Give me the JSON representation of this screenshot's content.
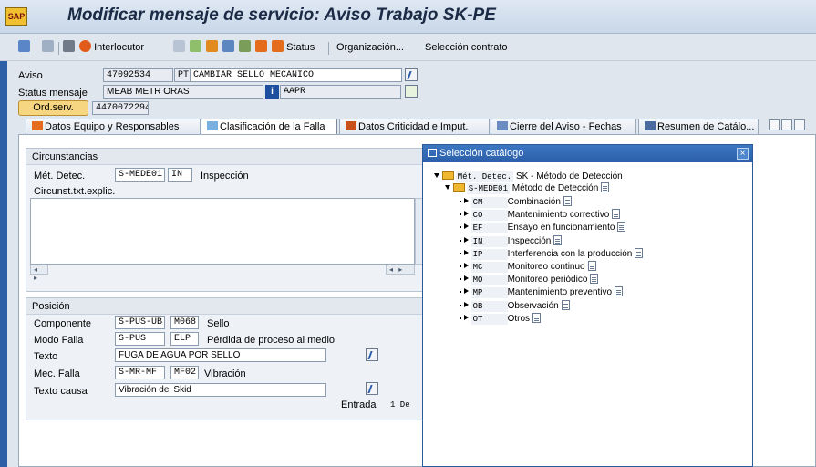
{
  "window": {
    "title": "Modificar mensaje de servicio: Aviso Trabajo SK-PE",
    "app_icon_text": "SAP"
  },
  "toolbar": {
    "interlocutor_label": "Interlocutor",
    "status_label": "Status",
    "organizacion_label": "Organización...",
    "seleccion_contrato_label": "Selección contrato"
  },
  "header": {
    "aviso_label": "Aviso",
    "aviso_number": "47092534",
    "aviso_type": "PT",
    "aviso_desc": "CAMBIAR SELLO MECANICO",
    "status_label": "Status mensaje",
    "status_value": "MEAB METR ORAS",
    "status_info": "AAPR",
    "ordserv_label": "Ord.serv.",
    "ordserv_value": "4470072294"
  },
  "tabs": [
    {
      "label": "Datos Equipo y Responsables"
    },
    {
      "label": "Clasificación de la Falla"
    },
    {
      "label": "Datos Criticidad e Imput."
    },
    {
      "label": "Cierre del Aviso - Fechas"
    },
    {
      "label": "Resumen de Catálo..."
    }
  ],
  "circunstancias": {
    "title": "Circunstancias",
    "met_detec_label": "Mét. Detec.",
    "met_detec_group": "S-MEDE01",
    "met_detec_code": "IN",
    "met_detec_text": "Inspección",
    "txt_label": "Circunst.txt.explic."
  },
  "posicion": {
    "title": "Posición",
    "componente_label": "Componente",
    "componente_group": "S-PUS-UB",
    "componente_code": "M068",
    "componente_text": "Sello",
    "modo_label": "Modo Falla",
    "modo_group": "S-PUS",
    "modo_code": "ELP",
    "modo_text": "Pérdida de proceso al medio",
    "texto_label": "Texto",
    "texto_value": "FUGA DE AGUA POR SELLO",
    "mec_label": "Mec. Falla",
    "mec_group": "S-MR-MF",
    "mec_code": "MF02",
    "mec_text": "Vibración",
    "causa_label": "Texto causa",
    "causa_value": "Vibración del Skid",
    "entrada_label": "Entrada",
    "entrada_value": "1 De"
  },
  "popup": {
    "title": "Selección catálogo",
    "close": "×",
    "root_code": "Mét. Detec.",
    "root_text": "SK - Método de Detección",
    "group_code": "S-MEDE01",
    "group_text": "Método de Detección",
    "items": [
      {
        "code": "CM",
        "text": "Combinación"
      },
      {
        "code": "CO",
        "text": "Mantenimiento correctivo"
      },
      {
        "code": "EF",
        "text": "Ensayo en funcionamiento"
      },
      {
        "code": "IN",
        "text": "Inspección"
      },
      {
        "code": "IP",
        "text": "Interferencia con la producción"
      },
      {
        "code": "MC",
        "text": "Monitoreo continuo"
      },
      {
        "code": "MO",
        "text": "Monitoreo periódico"
      },
      {
        "code": "MP",
        "text": "Mantenimiento preventivo"
      },
      {
        "code": "OB",
        "text": "Observación"
      },
      {
        "code": "OT",
        "text": "Otros"
      }
    ]
  }
}
